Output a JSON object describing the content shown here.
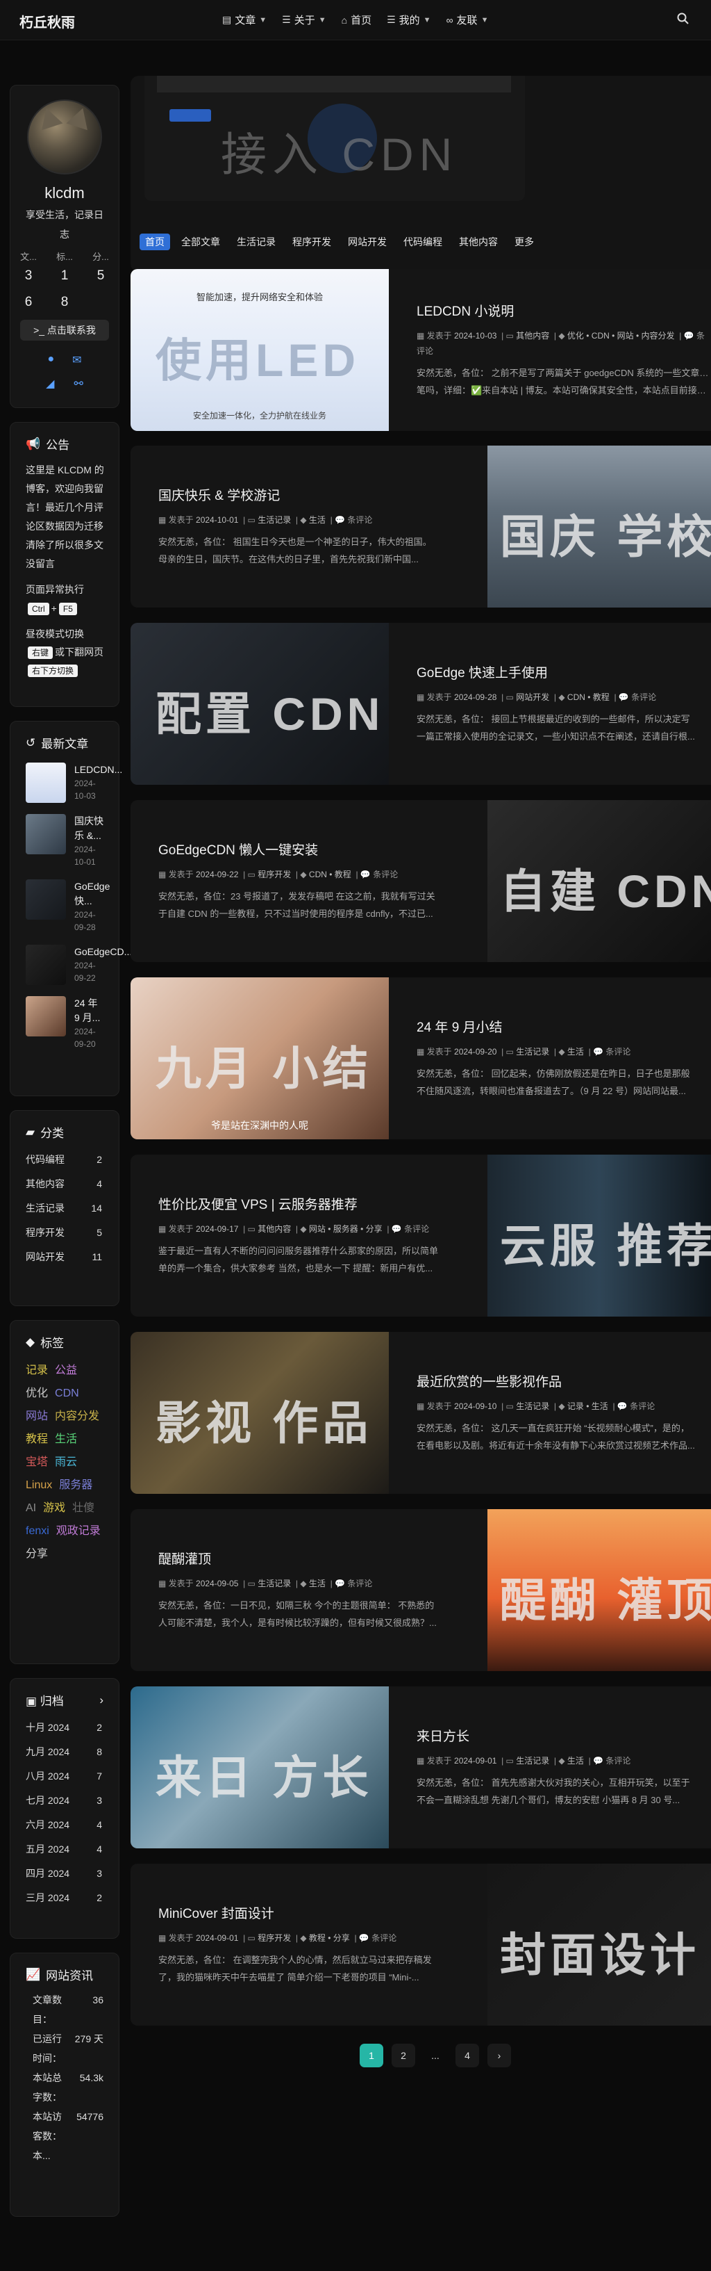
{
  "header": {
    "brand": "朽丘秋雨",
    "nav": [
      {
        "label": "文章",
        "icon": "book-icon",
        "dropdown": true
      },
      {
        "label": "关于",
        "icon": "list-icon",
        "dropdown": true
      },
      {
        "label": "首页",
        "icon": "home-icon",
        "dropdown": false
      },
      {
        "label": "我的",
        "icon": "list-icon",
        "dropdown": true
      },
      {
        "label": "友联",
        "icon": "link-icon",
        "dropdown": true
      }
    ]
  },
  "profile": {
    "name": "klcdm",
    "desc": "享受生活，记录日志",
    "stat_labels": [
      "文...",
      "标...",
      "分..."
    ],
    "stat_values": [
      "3",
      "1",
      "5"
    ],
    "stat_values2": [
      "6",
      "8",
      ""
    ],
    "follow": "点击联系我"
  },
  "announcement": {
    "title": "公告",
    "body": "这里是 KLCDM 的博客，欢迎向我留言！最近几个月评论区数据因为迁移清除了所以很多文没留言",
    "exception": "页面异常执行",
    "key1": "Ctrl",
    "key2": "F5",
    "dark_line1": "昼夜模式切换",
    "dark_key": "右键",
    "dark_line2": "或下翻网页",
    "dark_key2": "右下方切换"
  },
  "recent": {
    "title": "最新文章",
    "items": [
      {
        "title": "LEDCDN...",
        "date": "2024-10-03"
      },
      {
        "title": "国庆快乐 &...",
        "date": "2024-10-01"
      },
      {
        "title": "GoEdge 快...",
        "date": "2024-09-28"
      },
      {
        "title": "GoEdgeCD...",
        "date": "2024-09-22"
      },
      {
        "title": "24 年 9 月...",
        "date": "2024-09-20"
      }
    ]
  },
  "categories": {
    "title": "分类",
    "items": [
      {
        "name": "代码编程",
        "count": "2"
      },
      {
        "name": "其他内容",
        "count": "4"
      },
      {
        "name": "生活记录",
        "count": "14"
      },
      {
        "name": "程序开发",
        "count": "5"
      },
      {
        "name": "网站开发",
        "count": "11"
      }
    ]
  },
  "tags": {
    "title": "标签",
    "items": [
      {
        "name": "记录",
        "color": "#d6c24a"
      },
      {
        "name": "公益",
        "color": "#c07bd6"
      },
      {
        "name": "优化",
        "color": "#c9c9c9"
      },
      {
        "name": "CDN",
        "color": "#7a7fd6"
      },
      {
        "name": "网站",
        "color": "#8a7bd6"
      },
      {
        "name": "内容分发",
        "color": "#c9b24a"
      },
      {
        "name": "教程",
        "color": "#d6c24a"
      },
      {
        "name": "生活",
        "color": "#5ad67a"
      },
      {
        "name": "宝塔",
        "color": "#d65a5a"
      },
      {
        "name": "雨云",
        "color": "#4ab6d6"
      },
      {
        "name": "Linux",
        "color": "#d6a24a"
      },
      {
        "name": "服务器",
        "color": "#7a7fd6"
      },
      {
        "name": "AI",
        "color": "#8a8a8a"
      },
      {
        "name": "游戏",
        "color": "#d6c24a"
      },
      {
        "name": "壮傻",
        "color": "#6a6a6a"
      },
      {
        "name": "fenxi",
        "color": "#3a6ad6"
      },
      {
        "name": "观政记录",
        "color": "#c07bd6"
      },
      {
        "name": "分享",
        "color": "#d0d0d0"
      }
    ]
  },
  "archive": {
    "title": "归档",
    "items": [
      {
        "month": "十月 2024",
        "count": "2"
      },
      {
        "month": "九月 2024",
        "count": "8"
      },
      {
        "month": "八月 2024",
        "count": "7"
      },
      {
        "month": "七月 2024",
        "count": "3"
      },
      {
        "month": "六月 2024",
        "count": "4"
      },
      {
        "month": "五月 2024",
        "count": "4"
      },
      {
        "month": "四月 2024",
        "count": "3"
      },
      {
        "month": "三月 2024",
        "count": "2"
      }
    ]
  },
  "site_info": {
    "title": "网站资讯",
    "items": [
      {
        "label": "文章数目：",
        "value": "36"
      },
      {
        "label": "已运行时间：",
        "value": "279 天"
      },
      {
        "label": "本站总字数：",
        "value": "54.3k"
      },
      {
        "label": "本站访客数：",
        "value": "54776"
      },
      {
        "label": "本...",
        "value": ""
      }
    ]
  },
  "hero": {
    "title": "接入 CDN"
  },
  "tabs": [
    "首页",
    "全部文章",
    "生活记录",
    "程序开发",
    "网站开发",
    "代码编程",
    "其他内容",
    "更多"
  ],
  "posts": [
    {
      "title": "LEDCDN 小说明",
      "date": "2024-10-03",
      "cat": "其他内容",
      "tags": "优化 • CDN • 网站 • 内容分发",
      "comments": "条评论",
      "excerpt": "安然无恙，各位： 之前不是写了两篇关于 goedgeCDN 系统的一些文章嘛，",
      "excerpt2": "笔吗，详细：✅来自本站 | 博友。本站可确保其安全性，本站点目前接入 DN...",
      "thumb_text": "使用LED",
      "thumb_top": "智能加速，提升网络安全和体验",
      "thumb_bottom": "安全加速一体化，全力护航在线业务"
    },
    {
      "title": "国庆快乐 & 学校游记",
      "date": "2024-10-01",
      "cat": "生活记录",
      "tags": "生活",
      "comments": "条评论",
      "excerpt": "安然无恙，各位： 祖国生日今天也是一个神圣的日子，伟大的祖国。",
      "excerpt2": "母亲的生日，国庆节。在这伟大的日子里，首先先祝我们新中国...",
      "thumb_text": "国庆 学校"
    },
    {
      "title": "GoEdge 快速上手使用",
      "date": "2024-09-28",
      "cat": "网站开发",
      "tags": "CDN • 教程",
      "comments": "条评论",
      "excerpt": "安然无恙，各位： 接回上节根据最近的收到的一些邮件，所以决定写",
      "excerpt2": "一篇正常接入使用的全记录文，一些小知识点不在阐述，还请自行根...",
      "thumb_text": "配置 CDN"
    },
    {
      "title": "GoEdgeCDN 懒人一键安装",
      "date": "2024-09-22",
      "cat": "程序开发",
      "tags": "CDN • 教程",
      "comments": "条评论",
      "excerpt": "安然无恙，各位：23 号报道了，发发存稿吧 在这之前，我就有写过关",
      "excerpt2": "于自建 CDN 的一些教程，只不过当时使用的程序是 cdnfly，不过已...",
      "thumb_text": "自建 CDN"
    },
    {
      "title": "24 年 9 月小结",
      "date": "2024-09-20",
      "cat": "生活记录",
      "tags": "生活",
      "comments": "条评论",
      "excerpt": "安然无恙，各位： 回忆起来，仿佛刚放假还是在昨日，日子也是那般",
      "excerpt2": "不住随风逐流，转眼间也准备报道去了。（9 月 22 号）网站同站最...",
      "thumb_text": "九月 小结",
      "thumb_caption": "爷是站在深渊中的人呢"
    },
    {
      "title": "性价比及便宜 VPS | 云服务器推荐",
      "date": "2024-09-17",
      "cat": "其他内容",
      "tags": "网站 • 服务器 • 分享",
      "comments": "条评论",
      "excerpt": "鉴于最近一直有人不断的问问问服务器推荐什么那家的原因，所以简单",
      "excerpt2": "单的弄一个集合，供大家参考 当然，也是水一下 提醒：新用户有优...",
      "thumb_text": "云服 推荐"
    },
    {
      "title": "最近欣赏的一些影视作品",
      "date": "2024-09-10",
      "cat": "生活记录",
      "tags": "记录 • 生活",
      "comments": "条评论",
      "excerpt": "安然无恙，各位： 这几天一直在疯狂开始 “长视频耐心模式”，是的，",
      "excerpt2": "在看电影以及剧。将近有近十余年没有静下心来欣赏过视频艺术作品...",
      "thumb_text": "影视 作品"
    },
    {
      "title": "醍醐灌顶",
      "date": "2024-09-05",
      "cat": "生活记录",
      "tags": "生活",
      "comments": "条评论",
      "excerpt": "安然无恙，各位：一日不见，如隔三秋 今个的主题很简单： 不熟悉的",
      "excerpt2": "人可能不清楚，我个人，是有时候比较浮躁的，但有时候又很成熟？...",
      "thumb_text": "醍醐 灌顶"
    },
    {
      "title": "来日方长",
      "date": "2024-09-01",
      "cat": "生活记录",
      "tags": "生活",
      "comments": "条评论",
      "excerpt": "安然无恙，各位： 首先先感谢大伙对我的关心，互相开玩笑，以至于",
      "excerpt2": "不会一直糊涂乱想 先谢几个哥们，博友的安慰 小猫再 8 月 30 号...",
      "thumb_text": "来日 方长"
    },
    {
      "title": "MiniCover 封面设计",
      "date": "2024-09-01",
      "cat": "程序开发",
      "tags": "教程 • 分享",
      "comments": "条评论",
      "excerpt": "安然无恙，各位： 在调整完我个人的心情，然后就立马过来把存稿发",
      "excerpt2": "了，我的猫咪昨天中午去喵星了 简单介绍一下老哥的项目 “Mini-...",
      "thumb_text": "封面设计"
    }
  ],
  "meta_labels": {
    "posted": "发表于"
  },
  "pagination": [
    "1",
    "2",
    "...",
    "4"
  ]
}
